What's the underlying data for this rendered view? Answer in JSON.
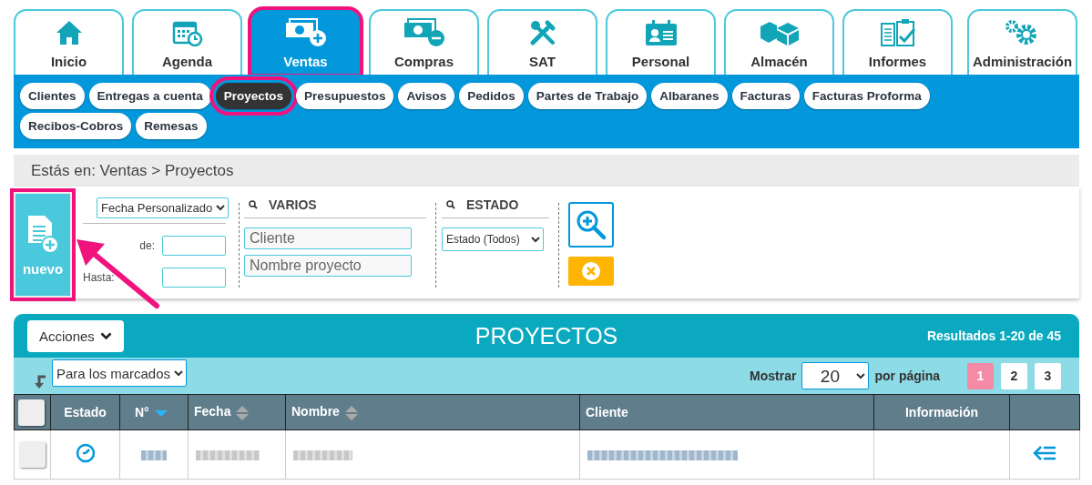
{
  "main_tabs": [
    {
      "label": "Inicio",
      "selected": false,
      "highlighted": false
    },
    {
      "label": "Agenda",
      "selected": false,
      "highlighted": false
    },
    {
      "label": "Ventas",
      "selected": true,
      "highlighted": true
    },
    {
      "label": "Compras",
      "selected": false,
      "highlighted": false
    },
    {
      "label": "SAT",
      "selected": false,
      "highlighted": false
    },
    {
      "label": "Personal",
      "selected": false,
      "highlighted": false
    },
    {
      "label": "Almacén",
      "selected": false,
      "highlighted": false
    },
    {
      "label": "Informes",
      "selected": false,
      "highlighted": false
    },
    {
      "label": "Administración",
      "selected": false,
      "highlighted": false
    }
  ],
  "sub_tabs": [
    {
      "label": "Clientes",
      "selected": false,
      "highlighted": false
    },
    {
      "label": "Entregas a cuenta",
      "selected": false,
      "highlighted": false
    },
    {
      "label": "Proyectos",
      "selected": true,
      "highlighted": true
    },
    {
      "label": "Presupuestos",
      "selected": false,
      "highlighted": false
    },
    {
      "label": "Avisos",
      "selected": false,
      "highlighted": false
    },
    {
      "label": "Pedidos",
      "selected": false,
      "highlighted": false
    },
    {
      "label": "Partes de Trabajo",
      "selected": false,
      "highlighted": false
    },
    {
      "label": "Albaranes",
      "selected": false,
      "highlighted": false
    },
    {
      "label": "Facturas",
      "selected": false,
      "highlighted": false
    },
    {
      "label": "Facturas Proforma",
      "selected": false,
      "highlighted": false
    },
    {
      "label": "Recibos-Cobros",
      "selected": false,
      "highlighted": false
    },
    {
      "label": "Remesas",
      "selected": false,
      "highlighted": false
    }
  ],
  "breadcrumb": "Estás en: Ventas > Proyectos",
  "new_button": {
    "label": "nuevo",
    "highlighted": true
  },
  "annotation_arrow": true,
  "filters": {
    "date": {
      "select": "Fecha Personalizado",
      "from_label": "de:",
      "to_label": "Hasta:"
    },
    "varios": {
      "title": "VARIOS",
      "fields": [
        {
          "placeholder": "Cliente"
        },
        {
          "placeholder": "Nombre proyecto"
        }
      ]
    },
    "estado": {
      "title": "ESTADO",
      "select": "Estado (Todos)"
    }
  },
  "table": {
    "actions_button": "Acciones",
    "title": "PROYECTOS",
    "results": "Resultados 1-20 de 45",
    "bulk_select": "Para los marcados",
    "show_label": "Mostrar",
    "page_size": "20",
    "per_page_label": "por página",
    "pages": [
      {
        "label": "1",
        "selected": true
      },
      {
        "label": "2",
        "selected": false
      },
      {
        "label": "3",
        "selected": false
      }
    ],
    "select_all_checked": false,
    "columns": [
      {
        "label": "Estado"
      },
      {
        "label": "N°",
        "sorted": true
      },
      {
        "label": "Fecha",
        "sorted": false
      },
      {
        "label": "Nombre",
        "sorted": false
      },
      {
        "label": "Cliente"
      },
      {
        "label": "Información"
      }
    ],
    "rows": [
      {
        "checked": false,
        "cells": [
          {
            "kind": "status-icon"
          },
          {
            "kind": "blurred-link"
          },
          {
            "kind": "blurred"
          },
          {
            "kind": "blurred"
          },
          {
            "kind": "blurred-link"
          },
          {
            "kind": "empty"
          },
          {
            "kind": "action-icon"
          }
        ]
      }
    ]
  }
}
